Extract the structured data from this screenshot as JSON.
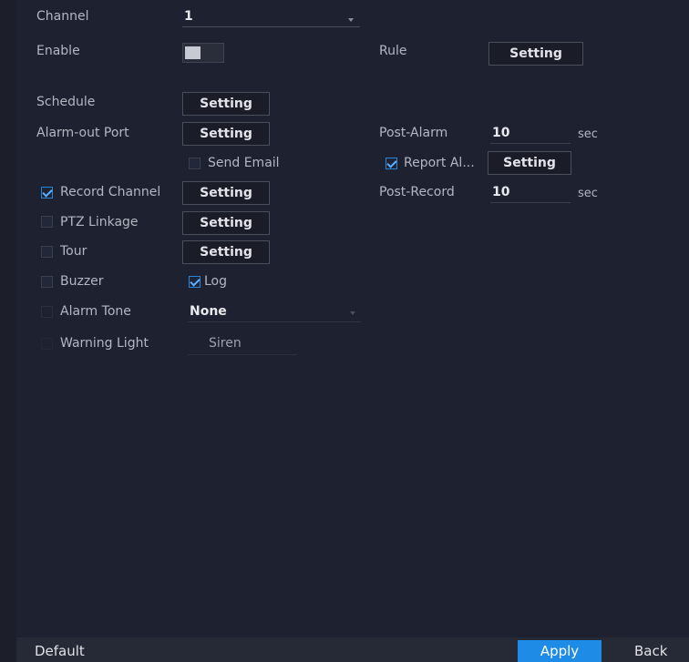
{
  "form": {
    "channel_label": "Channel",
    "channel_value": "1",
    "enable_label": "Enable",
    "rule_label": "Rule",
    "rule_button": "Setting",
    "schedule_label": "Schedule",
    "schedule_button": "Setting",
    "alarm_out_label": "Alarm-out Port",
    "alarm_out_button": "Setting",
    "post_alarm_label": "Post-Alarm",
    "post_alarm_value": "10",
    "post_alarm_unit": "sec",
    "send_email_label": "Send Email",
    "send_email_checked": false,
    "report_alarm_label": "Report Al...",
    "report_alarm_checked": true,
    "report_alarm_button": "Setting",
    "record_channel_label": "Record Channel",
    "record_channel_checked": true,
    "record_channel_button": "Setting",
    "post_record_label": "Post-Record",
    "post_record_value": "10",
    "post_record_unit": "sec",
    "ptz_label": "PTZ Linkage",
    "ptz_button": "Setting",
    "tour_label": "Tour",
    "tour_button": "Setting",
    "buzzer_label": "Buzzer",
    "log_label": "Log",
    "log_checked": true,
    "alarm_tone_label": "Alarm Tone",
    "alarm_tone_value": "None",
    "warning_light_label": "Warning Light",
    "warning_light_value": "Siren"
  },
  "footer": {
    "default_label": "Default",
    "apply_label": "Apply",
    "back_label": "Back"
  },
  "colors": {
    "accent": "#1e8be6",
    "background": "#1e2230"
  }
}
